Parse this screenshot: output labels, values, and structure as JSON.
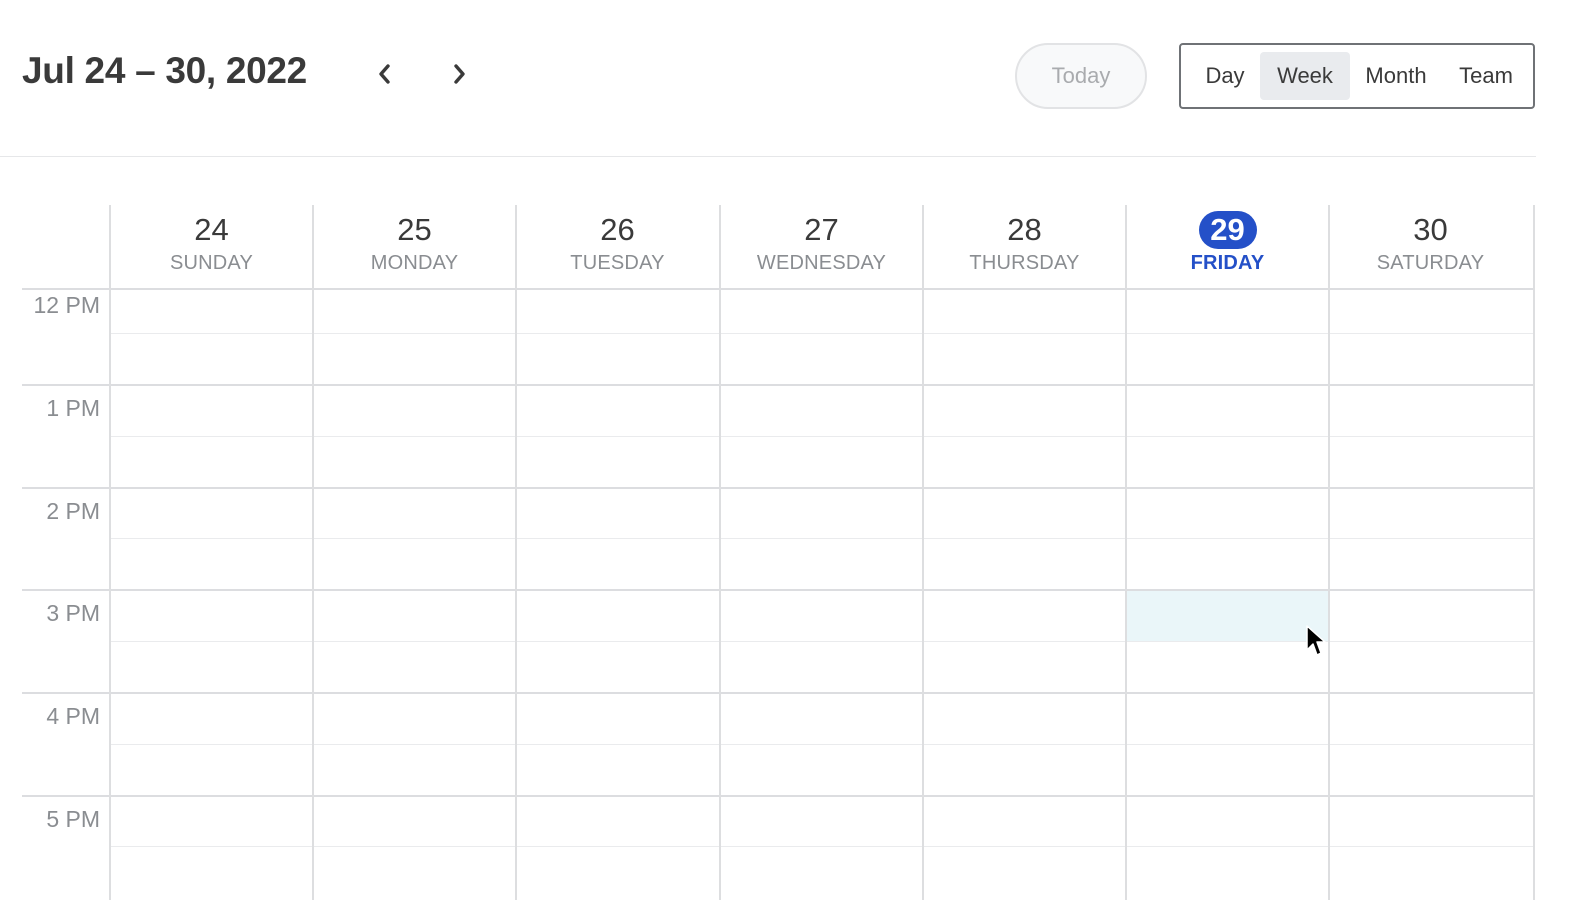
{
  "header": {
    "date_range": "Jul 24 – 30, 2022",
    "today_label": "Today",
    "views": [
      {
        "label": "Day",
        "active": false
      },
      {
        "label": "Week",
        "active": true
      },
      {
        "label": "Month",
        "active": false
      },
      {
        "label": "Team",
        "active": false
      }
    ],
    "prev_icon": "chevron-left-icon",
    "next_icon": "chevron-right-icon"
  },
  "days": [
    {
      "num": "24",
      "name": "SUNDAY",
      "today": false
    },
    {
      "num": "25",
      "name": "MONDAY",
      "today": false
    },
    {
      "num": "26",
      "name": "TUESDAY",
      "today": false
    },
    {
      "num": "27",
      "name": "WEDNESDAY",
      "today": false
    },
    {
      "num": "28",
      "name": "THURSDAY",
      "today": false
    },
    {
      "num": "29",
      "name": "FRIDAY",
      "today": true
    },
    {
      "num": "30",
      "name": "SATURDAY",
      "today": false
    }
  ],
  "hours": [
    "12 PM",
    "1 PM",
    "2 PM",
    "3 PM",
    "4 PM",
    "5 PM"
  ],
  "hover_slot": {
    "day": "FRIDAY",
    "time": "3 PM"
  },
  "colors": {
    "accent": "#2450c8",
    "hover_slot": "#eaf6f9",
    "grid": "#dddee0",
    "muted_text": "#8a8d91"
  }
}
